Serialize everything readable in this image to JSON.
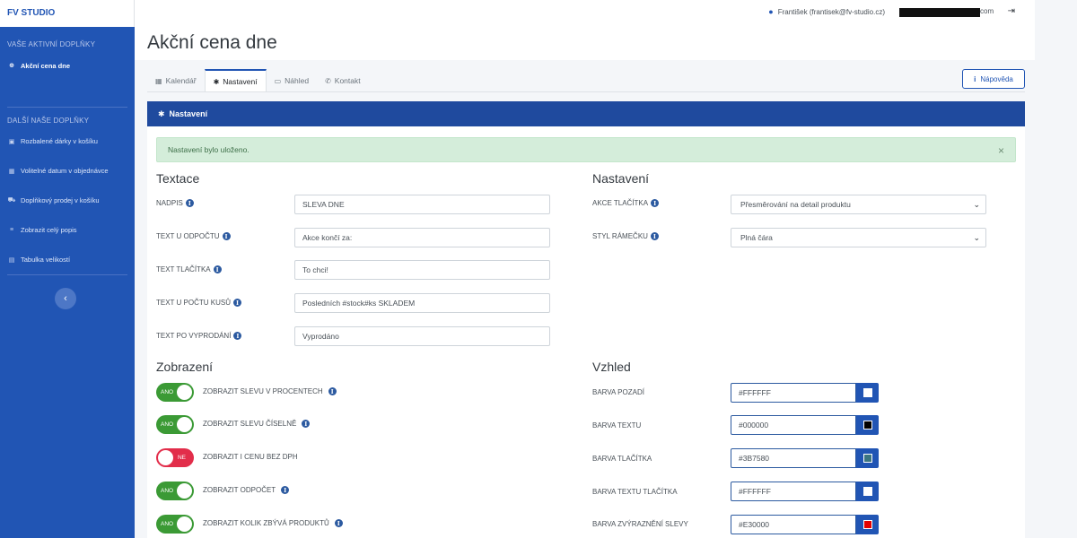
{
  "sidebar": {
    "brand": "FV STUDIO",
    "active_heading": "VAŠE AKTIVNÍ DOPLŇKY",
    "active_item": "Akční cena dne",
    "other_heading": "DALŠÍ NAŠE DOPLŇKY",
    "items": [
      {
        "label": "Rozbalené dárky v košíku",
        "icon": "gift-icon"
      },
      {
        "label": "Volitelné datum v objednávce",
        "icon": "calendar-icon"
      },
      {
        "label": "Doplňkový prodej v košíku",
        "icon": "cart-icon"
      },
      {
        "label": "Zobrazit celý popis",
        "icon": "text-icon"
      },
      {
        "label": "Tabulka velikostí",
        "icon": "table-icon"
      }
    ],
    "collapse_glyph": "‹"
  },
  "topbar": {
    "user": "František (frantisek@fv-studio.cz)",
    "email_suffix": "com"
  },
  "page": {
    "title": "Akční cena dne"
  },
  "tabs": [
    {
      "label": "Kalendář"
    },
    {
      "label": "Nastavení"
    },
    {
      "label": "Náhled"
    },
    {
      "label": "Kontakt"
    }
  ],
  "help_label": "Nápověda",
  "card": {
    "header": "Nastavení",
    "alert": "Nastavení bylo uloženo.",
    "alert_close": "×"
  },
  "texts": {
    "title": "Textace",
    "fields": [
      {
        "label": "NADPIS",
        "value": "SLEVA DNE"
      },
      {
        "label": "TEXT U ODPOČTU",
        "value": "Akce končí za:"
      },
      {
        "label": "TEXT TLAČÍTKA",
        "value": "To chci!"
      },
      {
        "label": "TEXT U POČTU KUSŮ",
        "value": "Posledních #stock#ks SKLADEM"
      },
      {
        "label": "TEXT PO VYPRODÁNÍ",
        "value": "Vyprodáno"
      }
    ]
  },
  "settings": {
    "title": "Nastavení",
    "fields": [
      {
        "label": "AKCE TLAČÍTKA",
        "value": "Přesměrování na detail produktu"
      },
      {
        "label": "STYL RÁMEČKU",
        "value": "Plná čára"
      }
    ]
  },
  "display": {
    "title": "Zobrazení",
    "toggles": [
      {
        "label": "ZOBRAZIT SLEVU V PROCENTECH",
        "state": "ANO",
        "on": true,
        "info": true
      },
      {
        "label": "ZOBRAZIT SLEVU ČÍSELNĚ",
        "state": "ANO",
        "on": true,
        "info": true
      },
      {
        "label": "ZOBRAZIT I CENU BEZ DPH",
        "state": "NE",
        "on": false,
        "info": false
      },
      {
        "label": "ZOBRAZIT ODPOČET",
        "state": "ANO",
        "on": true,
        "info": true
      },
      {
        "label": "ZOBRAZIT KOLIK ZBÝVÁ PRODUKTŮ",
        "state": "ANO",
        "on": true,
        "info": true
      }
    ]
  },
  "appearance": {
    "title": "Vzhled",
    "colors": [
      {
        "label": "BARVA POZADÍ",
        "value": "#FFFFFF",
        "swatch": "#FFFFFF"
      },
      {
        "label": "BARVA TEXTU",
        "value": "#000000",
        "swatch": "#000000"
      },
      {
        "label": "BARVA TLAČÍTKA",
        "value": "#3B7580",
        "swatch": "#3B7580"
      },
      {
        "label": "BARVA TEXTU TLAČÍTKA",
        "value": "#FFFFFF",
        "swatch": "#FFFFFF"
      },
      {
        "label": "BARVA ZVÝRAZNĚNÍ SLEVY",
        "value": "#E30000",
        "swatch": "#E30000"
      }
    ]
  },
  "info_glyph": "i",
  "colors": {
    "primary": "#2155b4",
    "header": "#1f4a9e",
    "toggle_on": "#3b9a35",
    "toggle_off": "#e22d4a",
    "alert_bg": "#d4edda"
  }
}
